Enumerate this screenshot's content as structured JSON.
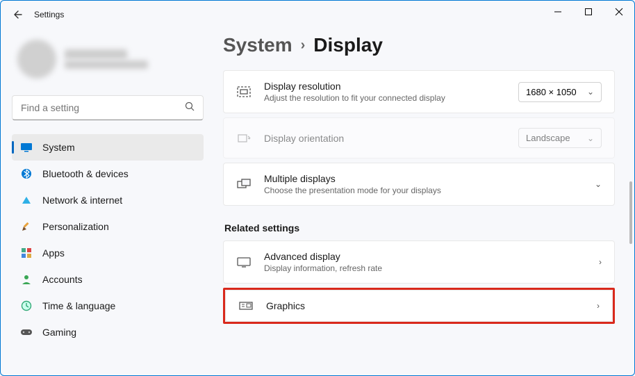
{
  "window": {
    "title": "Settings"
  },
  "search": {
    "placeholder": "Find a setting"
  },
  "nav": {
    "items": [
      {
        "label": "System"
      },
      {
        "label": "Bluetooth & devices"
      },
      {
        "label": "Network & internet"
      },
      {
        "label": "Personalization"
      },
      {
        "label": "Apps"
      },
      {
        "label": "Accounts"
      },
      {
        "label": "Time & language"
      },
      {
        "label": "Gaming"
      }
    ]
  },
  "breadcrumb": {
    "parent": "System",
    "current": "Display"
  },
  "cards": {
    "resolution": {
      "title": "Display resolution",
      "sub": "Adjust the resolution to fit your connected display",
      "value": "1680 × 1050"
    },
    "orientation": {
      "title": "Display orientation",
      "value": "Landscape"
    },
    "multiple": {
      "title": "Multiple displays",
      "sub": "Choose the presentation mode for your displays"
    }
  },
  "related": {
    "label": "Related settings",
    "advanced": {
      "title": "Advanced display",
      "sub": "Display information, refresh rate"
    },
    "graphics": {
      "title": "Graphics"
    }
  }
}
